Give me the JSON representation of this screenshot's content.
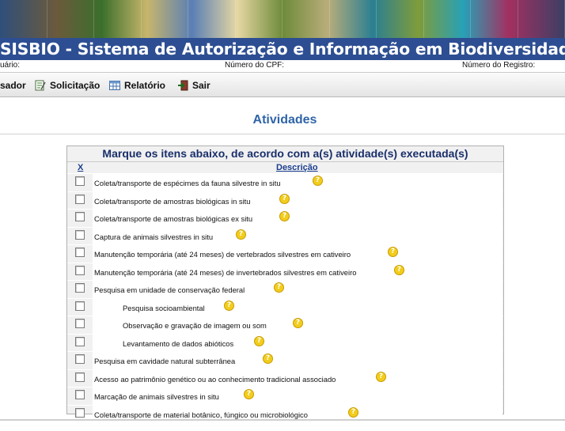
{
  "header": {
    "title": "SISBIO - Sistema de Autorização e Informação em Biodiversidade",
    "user_label": "uário:",
    "cpf_label": "Número do CPF:",
    "registro_label": "Número do Registro:"
  },
  "menu": [
    {
      "label": "sador",
      "icon": "user-icon"
    },
    {
      "label": "Solicitação",
      "icon": "request-form-icon"
    },
    {
      "label": "Relatório",
      "icon": "report-table-icon"
    },
    {
      "label": "Sair",
      "icon": "exit-door-icon"
    }
  ],
  "page_title": "Atividades",
  "panel": {
    "heading": "Marque os itens abaixo, de acordo com a(s) atividade(s) executada(s)",
    "col_x": "X",
    "col_desc": "Descrição",
    "help_symbol": "?",
    "items": [
      {
        "label": "Coleta/transporte de espécimes da fauna silvestre in situ",
        "indent": false
      },
      {
        "label": "Coleta/transporte de amostras biológicas in situ",
        "indent": false
      },
      {
        "label": "Coleta/transporte de amostras biológicas ex situ",
        "indent": false
      },
      {
        "label": "Captura de animais silvestres in situ",
        "indent": false
      },
      {
        "label": "Manutenção temporária (até 24 meses) de vertebrados silvestres em cativeiro",
        "indent": false
      },
      {
        "label": "Manutenção temporária (até 24 meses) de invertebrados silvestres em cativeiro",
        "indent": false
      },
      {
        "label": "Pesquisa em unidade de conservação federal",
        "indent": false
      },
      {
        "label": "Pesquisa socioambiental",
        "indent": true
      },
      {
        "label": "Observação e gravação de imagem ou som",
        "indent": true
      },
      {
        "label": "Levantamento de dados abióticos",
        "indent": true
      },
      {
        "label": "Pesquisa em cavidade natural subterrânea",
        "indent": false
      },
      {
        "label": "Acesso ao patrimônio genético ou ao conhecimento tradicional associado",
        "indent": false
      },
      {
        "label": "Marcação de animais silvestres in situ",
        "indent": false
      },
      {
        "label": "Coleta/transporte de material botânico, fúngico ou microbiológico",
        "indent": false
      }
    ]
  }
}
